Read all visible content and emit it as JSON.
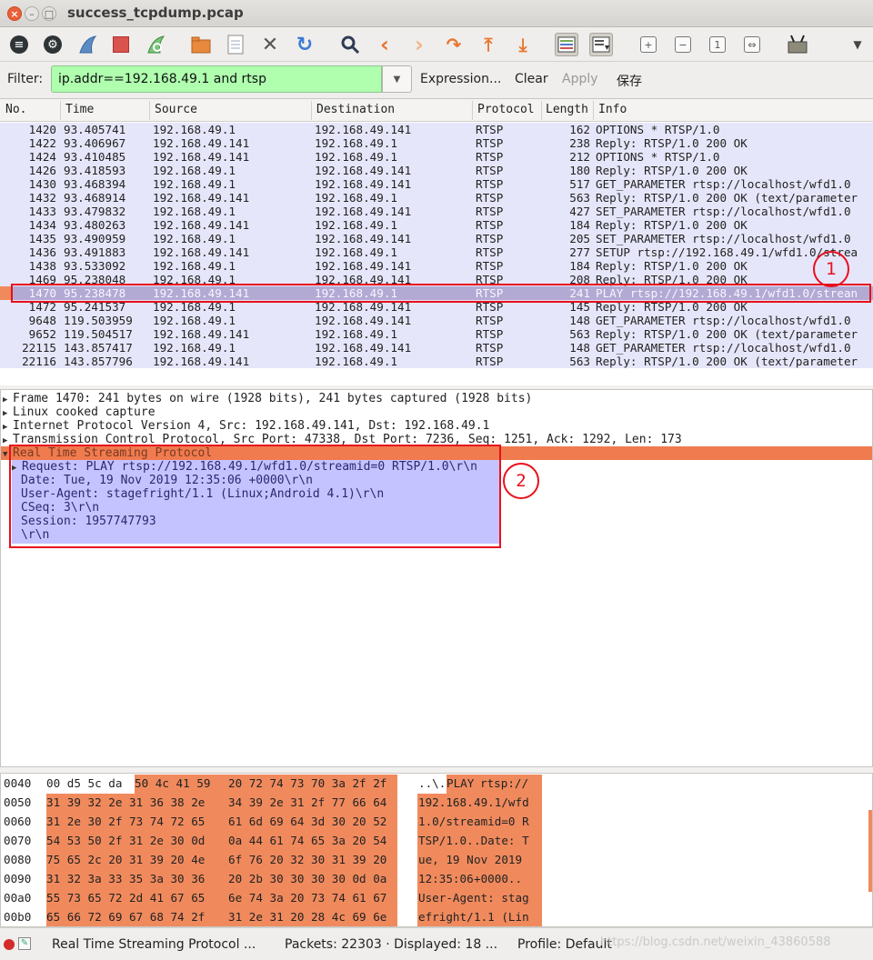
{
  "window": {
    "title": "success_tcpdump.pcap",
    "close_glyph": "×",
    "min_glyph": "–",
    "max_glyph": "□"
  },
  "toolbar": {
    "icons": [
      "list-icon",
      "gear-icon",
      "shark-fin-start-icon",
      "stop-square-icon",
      "restart-icon",
      "open-folder-icon",
      "file-icon",
      "close-x-icon",
      "reload-icon",
      "search-icon",
      "back-arrow-icon",
      "forward-arrow-icon",
      "go-to-icon",
      "first-packet-icon",
      "last-packet-icon",
      "colorize-icon",
      "autoscroll-icon",
      "zoom-in-icon",
      "zoom-out-icon",
      "zoom-normal-icon",
      "resize-columns-icon",
      "wireless-icon",
      "more-dropdown-icon"
    ]
  },
  "filter": {
    "label": "Filter:",
    "value": "ip.addr==192.168.49.1 and rtsp",
    "expression": "Expression...",
    "clear": "Clear",
    "apply": "Apply",
    "save": "保存"
  },
  "columns": [
    "No.",
    "Time",
    "Source",
    "Destination",
    "Protocol",
    "Length",
    "Info"
  ],
  "packets": [
    {
      "no": "1420",
      "time": "93.405741",
      "src": "192.168.49.1",
      "dst": "192.168.49.141",
      "proto": "RTSP",
      "len": "162",
      "info": "OPTIONS * RTSP/1.0"
    },
    {
      "no": "1422",
      "time": "93.406967",
      "src": "192.168.49.141",
      "dst": "192.168.49.1",
      "proto": "RTSP",
      "len": "238",
      "info": "Reply: RTSP/1.0 200 OK"
    },
    {
      "no": "1424",
      "time": "93.410485",
      "src": "192.168.49.141",
      "dst": "192.168.49.1",
      "proto": "RTSP",
      "len": "212",
      "info": "OPTIONS * RTSP/1.0"
    },
    {
      "no": "1426",
      "time": "93.418593",
      "src": "192.168.49.1",
      "dst": "192.168.49.141",
      "proto": "RTSP",
      "len": "180",
      "info": "Reply: RTSP/1.0 200 OK"
    },
    {
      "no": "1430",
      "time": "93.468394",
      "src": "192.168.49.1",
      "dst": "192.168.49.141",
      "proto": "RTSP",
      "len": "517",
      "info": "GET_PARAMETER rtsp://localhost/wfd1.0"
    },
    {
      "no": "1432",
      "time": "93.468914",
      "src": "192.168.49.141",
      "dst": "192.168.49.1",
      "proto": "RTSP",
      "len": "563",
      "info": "Reply: RTSP/1.0 200 OK (text/parameter"
    },
    {
      "no": "1433",
      "time": "93.479832",
      "src": "192.168.49.1",
      "dst": "192.168.49.141",
      "proto": "RTSP",
      "len": "427",
      "info": "SET_PARAMETER rtsp://localhost/wfd1.0"
    },
    {
      "no": "1434",
      "time": "93.480263",
      "src": "192.168.49.141",
      "dst": "192.168.49.1",
      "proto": "RTSP",
      "len": "184",
      "info": "Reply: RTSP/1.0 200 OK"
    },
    {
      "no": "1435",
      "time": "93.490959",
      "src": "192.168.49.1",
      "dst": "192.168.49.141",
      "proto": "RTSP",
      "len": "205",
      "info": "SET_PARAMETER rtsp://localhost/wfd1.0"
    },
    {
      "no": "1436",
      "time": "93.491883",
      "src": "192.168.49.141",
      "dst": "192.168.49.1",
      "proto": "RTSP",
      "len": "277",
      "info": "SETUP rtsp://192.168.49.1/wfd1.0/strea"
    },
    {
      "no": "1438",
      "time": "93.533092",
      "src": "192.168.49.1",
      "dst": "192.168.49.141",
      "proto": "RTSP",
      "len": "184",
      "info": "Reply: RTSP/1.0 200 OK"
    },
    {
      "no": "1469",
      "time": "95.238048",
      "src": "192.168.49.1",
      "dst": "192.168.49.141",
      "proto": "RTSP",
      "len": "208",
      "info": "Reply: RTSP/1.0 200 OK"
    },
    {
      "no": "1470",
      "time": "95.238478",
      "src": "192.168.49.141",
      "dst": "192.168.49.1",
      "proto": "RTSP",
      "len": "241",
      "info": "PLAY rtsp://192.168.49.1/wfd1.0/strean"
    },
    {
      "no": "1472",
      "time": "95.241537",
      "src": "192.168.49.1",
      "dst": "192.168.49.141",
      "proto": "RTSP",
      "len": "145",
      "info": "Reply: RTSP/1.0 200 OK"
    },
    {
      "no": "9648",
      "time": "119.503959",
      "src": "192.168.49.1",
      "dst": "192.168.49.141",
      "proto": "RTSP",
      "len": "148",
      "info": "GET_PARAMETER rtsp://localhost/wfd1.0"
    },
    {
      "no": "9652",
      "time": "119.504517",
      "src": "192.168.49.141",
      "dst": "192.168.49.1",
      "proto": "RTSP",
      "len": "563",
      "info": "Reply: RTSP/1.0 200 OK (text/parameter"
    },
    {
      "no": "22115",
      "time": "143.857417",
      "src": "192.168.49.1",
      "dst": "192.168.49.141",
      "proto": "RTSP",
      "len": "148",
      "info": "GET_PARAMETER rtsp://localhost/wfd1.0"
    },
    {
      "no": "22116",
      "time": "143.857796",
      "src": "192.168.49.141",
      "dst": "192.168.49.1",
      "proto": "RTSP",
      "len": "563",
      "info": "Reply: RTSP/1.0 200 OK (text/parameter"
    }
  ],
  "selected_row": 12,
  "annotations": {
    "badge1": "1",
    "badge2": "2",
    "color": "#e8101c"
  },
  "detail": {
    "frame": "Frame 1470: 241 bytes on wire (1928 bits), 241 bytes captured (1928 bits)",
    "linux": "Linux cooked capture",
    "ip": "Internet Protocol Version 4, Src: 192.168.49.141, Dst: 192.168.49.1",
    "tcp": "Transmission Control Protocol, Src Port: 47338, Dst Port: 7236, Seq: 1251, Ack: 1292, Len: 173",
    "rtsp": "Real Time Streaming Protocol",
    "rtsp_fields": [
      "Request: PLAY rtsp://192.168.49.1/wfd1.0/streamid=0 RTSP/1.0\\r\\n",
      "Date: Tue, 19 Nov 2019 12:35:06 +0000\\r\\n",
      "User-Agent: stagefright/1.1 (Linux;Android 4.1)\\r\\n",
      "CSeq: 3\\r\\n",
      "Session: 1957747793",
      "\\r\\n"
    ]
  },
  "hex": [
    {
      "off": "0040",
      "g1": "00 d5 5c da",
      "g1b": "50 4c 41 59",
      "g2": "20 72 74 73 70 3a 2f 2f",
      "a1": "..\\.",
      "a1b": "PLAY",
      "a2": " rtsp://"
    },
    {
      "off": "0050",
      "g1": "",
      "g1b": "31 39 32 2e 31 36 38 2e",
      "g2": "34 39 2e 31 2f 77 66 64",
      "a1": "",
      "a1b": "192.168.",
      "a2": " 49.1/wfd"
    },
    {
      "off": "0060",
      "g1": "",
      "g1b": "31 2e 30 2f 73 74 72 65",
      "g2": "61 6d 69 64 3d 30 20 52",
      "a1": "",
      "a1b": "1.0/stre",
      "a2": " amid=0 R"
    },
    {
      "off": "0070",
      "g1": "",
      "g1b": "54 53 50 2f 31 2e 30 0d",
      "g2": "0a 44 61 74 65 3a 20 54",
      "a1": "",
      "a1b": "TSP/1.0.",
      "a2": " .Date: T"
    },
    {
      "off": "0080",
      "g1": "",
      "g1b": "75 65 2c 20 31 39 20 4e",
      "g2": "6f 76 20 32 30 31 39 20",
      "a1": "",
      "a1b": "ue, 19 N",
      "a2": " ov 2019 "
    },
    {
      "off": "0090",
      "g1": "",
      "g1b": "31 32 3a 33 35 3a 30 36",
      "g2": "20 2b 30 30 30 30 0d 0a",
      "a1": "",
      "a1b": "12:35:06",
      "a2": "  +0000.."
    },
    {
      "off": "00a0",
      "g1": "",
      "g1b": "55 73 65 72 2d 41 67 65",
      "g2": "6e 74 3a 20 73 74 61 67",
      "a1": "",
      "a1b": "User-Age",
      "a2": " nt: stag"
    },
    {
      "off": "00b0",
      "g1": "",
      "g1b": "65 66 72 69 67 68 74 2f",
      "g2": "31 2e 31 20 28 4c 69 6e",
      "a1": "",
      "a1b": "efright/",
      "a2": " 1.1 (Lin"
    }
  ],
  "status": {
    "protocol": "Real Time Streaming Protocol ...",
    "packets": "Packets: 22303 · Displayed: 18 ...",
    "profile": "Profile: Default",
    "watermark": "https://blog.csdn.net/weixin_43860588"
  }
}
